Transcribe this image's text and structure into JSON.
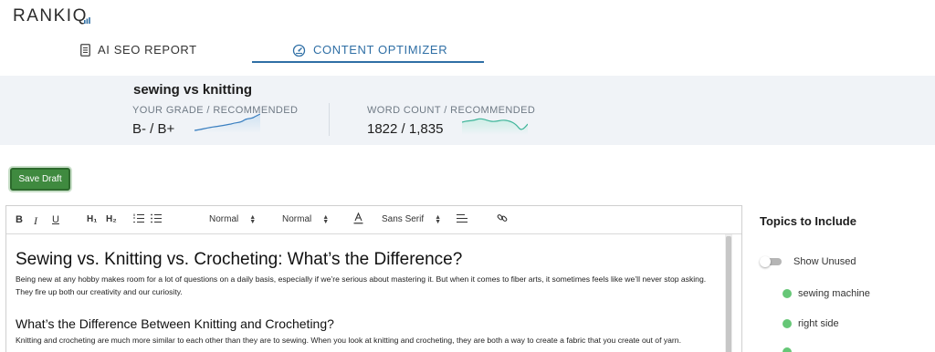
{
  "app": {
    "logo_text": "RANKIQ",
    "logo_main": "RANKI",
    "logo_last": "Q"
  },
  "tabs": [
    {
      "label": "AI SEO REPORT",
      "icon": "document-icon",
      "active": false
    },
    {
      "label": "CONTENT OPTIMIZER",
      "icon": "speedometer-icon",
      "active": true
    }
  ],
  "summary": {
    "keyword": "sewing vs knitting",
    "grade_label": "YOUR GRADE / RECOMMENDED",
    "grade_value": "B- / B+",
    "word_label": "WORD COUNT / RECOMMENDED",
    "word_value": "1822 / 1,835"
  },
  "actions": {
    "save_draft": "Save Draft"
  },
  "toolbar": {
    "bold": "B",
    "italic": "I",
    "underline": "U",
    "h1": "H₁",
    "h2": "H₂",
    "size_select": "Normal",
    "header_select": "Normal",
    "font_select": "Sans Serif"
  },
  "document": {
    "title": "Sewing vs. Knitting vs. Crocheting: What’s the Difference?",
    "intro": "Being new at any hobby makes room for a lot of questions on a daily basis, especially if we’re serious about mastering it. But when it comes to fiber arts, it sometimes feels like we’ll never stop asking. They fire up both our creativity and our curiosity.",
    "heading2": "What’s the Difference Between Knitting and Crocheting?",
    "para2": "Knitting and crocheting are much more similar to each other than they are to sewing. When you look at knitting and crocheting, they are both a way to create a fabric that you create out of yarn."
  },
  "topics_panel": {
    "title": "Topics to Include",
    "show_unused_label": "Show Unused",
    "show_unused_on": false,
    "topics": [
      {
        "label": "sewing machine",
        "status_color": "#66c777"
      },
      {
        "label": "right side",
        "status_color": "#66c777"
      },
      {
        "label": "",
        "status_color": "#66c777"
      }
    ]
  },
  "colors": {
    "accent": "#2f6fa5",
    "save_button": "#3f8a3f",
    "summary_bg": "#f0f3f7",
    "topic_used": "#66c777"
  }
}
